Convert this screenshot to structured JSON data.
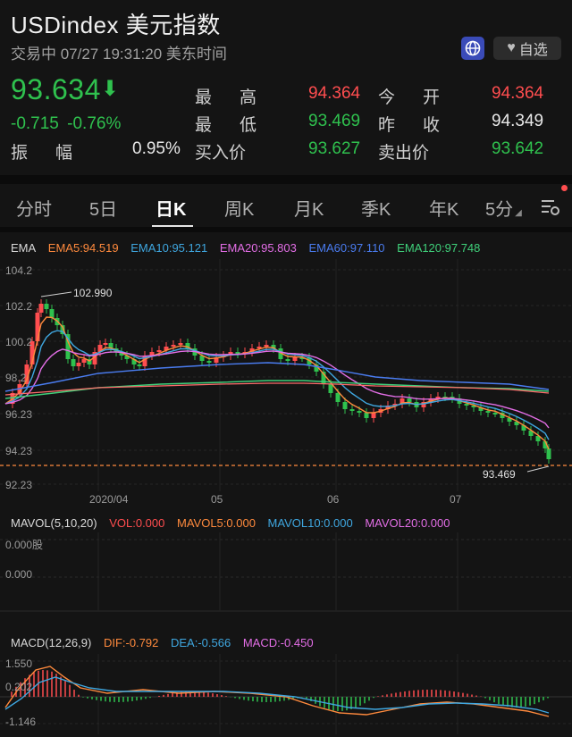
{
  "header": {
    "title": "USDindex  美元指数",
    "status": "交易中 07/27 19:31:20 美东时间",
    "fav_label": "自选"
  },
  "quote": {
    "price": "93.634",
    "change": "-0.715",
    "change_pct": "-0.76%",
    "amplitude_label": "振　幅",
    "amplitude": "0.95%",
    "high_label": "最　高",
    "high": "94.364",
    "low_label": "最　低",
    "low": "93.469",
    "bid_label": "买入价",
    "bid": "93.627",
    "open_label": "今　开",
    "open": "94.364",
    "prev_close_label": "昨　收",
    "prev_close": "94.349",
    "ask_label": "卖出价",
    "ask": "93.642"
  },
  "tabs": [
    "分时",
    "5日",
    "日K",
    "周K",
    "月K",
    "季K",
    "年K",
    "5分"
  ],
  "active_tab": "日K",
  "ema": {
    "label": "EMA",
    "items": [
      {
        "text": "EMA5:94.519",
        "color": "#ff8a3d"
      },
      {
        "text": "EMA10:95.121",
        "color": "#3fa7e0"
      },
      {
        "text": "EMA20:95.803",
        "color": "#e36ee6"
      },
      {
        "text": "EMA60:97.110",
        "color": "#4a7cf0"
      },
      {
        "text": "EMA120:97.748",
        "color": "#3fd07a"
      }
    ]
  },
  "price_axis": [
    "104.2",
    "102.2",
    "100.2",
    "98.2",
    "96.23",
    "94.23",
    "92.23"
  ],
  "max_annotation": "102.990",
  "min_annotation": "93.469",
  "date_axis": [
    "2020/04",
    "05",
    "06",
    "07"
  ],
  "mavol": {
    "label": "MAVOL(5,10,20)",
    "items": [
      {
        "text": "VOL:0.000",
        "color": "#ff4d4f"
      },
      {
        "text": "MAVOL5:0.000",
        "color": "#ff8a3d"
      },
      {
        "text": "MAVOL10:0.000",
        "color": "#3fa7e0"
      },
      {
        "text": "MAVOL20:0.000",
        "color": "#e36ee6"
      }
    ],
    "axis_top": "0.000股",
    "axis_bottom": "0.000"
  },
  "macd": {
    "label": "MACD(12,26,9)",
    "items": [
      {
        "text": "DIF:-0.792",
        "color": "#ff8a3d"
      },
      {
        "text": "DEA:-0.566",
        "color": "#3fa7e0"
      },
      {
        "text": "MACD:-0.450",
        "color": "#e36ee6"
      }
    ],
    "axis": [
      "1.550",
      "0.202",
      "-1.146"
    ]
  },
  "colors": {
    "up": "#ff4d4f",
    "down": "#2fc14e",
    "background": "#141414"
  }
}
